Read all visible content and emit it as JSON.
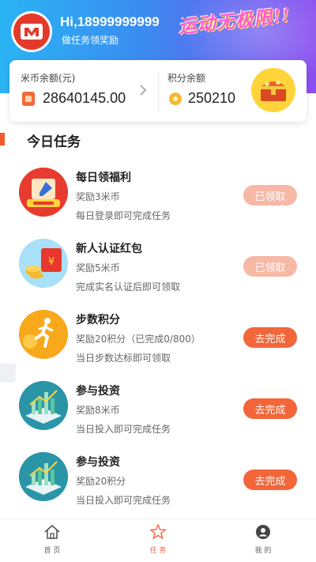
{
  "header": {
    "greeting": "Hi,18999999999",
    "subtitle": "做任务领奖励",
    "slogan": "运动无极限!!"
  },
  "balance": {
    "coin_label": "米币余额(元)",
    "coin_value": "28640145.00",
    "points_label": "积分余额",
    "points_value": "250210"
  },
  "section": {
    "title": "今日任务"
  },
  "tasks": [
    {
      "title": "每日领福利",
      "reward": "奖励3米币",
      "desc": "每日登录即可完成任务",
      "button": "已领取",
      "status": "done",
      "icon": "calendar-sign-icon"
    },
    {
      "title": "新人认证红包",
      "reward": "奖励5米币",
      "desc": "完成实名认证后即可领取",
      "button": "已领取",
      "status": "done",
      "icon": "red-envelope-icon"
    },
    {
      "title": "步数积分",
      "reward": "奖励20积分（已完成0/800）",
      "desc": "当日步数达标即可领取",
      "button": "去完成",
      "status": "todo",
      "icon": "runner-icon"
    },
    {
      "title": "参与投资",
      "reward": "奖励8米币",
      "desc": "当日投入即可完成任务",
      "button": "去完成",
      "status": "todo",
      "icon": "invest-chart-icon"
    },
    {
      "title": "参与投资",
      "reward": "奖励20积分",
      "desc": "当日投入即可完成任务",
      "button": "去完成",
      "status": "todo",
      "icon": "invest-chart-icon"
    }
  ],
  "nav": [
    {
      "label": "首 页",
      "icon": "home-icon",
      "active": false
    },
    {
      "label": "任 务",
      "icon": "star-icon",
      "active": true
    },
    {
      "label": "我 的",
      "icon": "user-icon",
      "active": false
    }
  ],
  "colors": {
    "accent": "#f2663a",
    "done_button": "#f7b8a6",
    "header_start": "#2bb4f4",
    "header_end": "#8c4ef0"
  }
}
